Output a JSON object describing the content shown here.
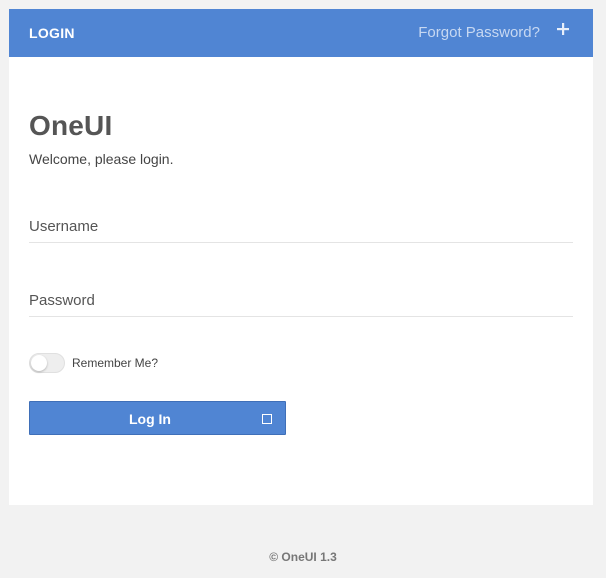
{
  "header": {
    "title": "LOGIN",
    "forgot_link": "Forgot Password?",
    "plus_icon": "plus-icon"
  },
  "brand": {
    "name": "OneUI",
    "welcome": "Welcome, please login."
  },
  "form": {
    "username_placeholder": "Username",
    "username_value": "",
    "password_placeholder": "Password",
    "password_value": "",
    "remember_label": "Remember Me?",
    "remember_checked": false,
    "submit_label": "Log In",
    "submit_icon": "square-icon"
  },
  "footer": {
    "text": "© OneUI 1.3"
  },
  "colors": {
    "accent": "#5085d3",
    "background": "#f2f2f2",
    "card": "#ffffff"
  }
}
